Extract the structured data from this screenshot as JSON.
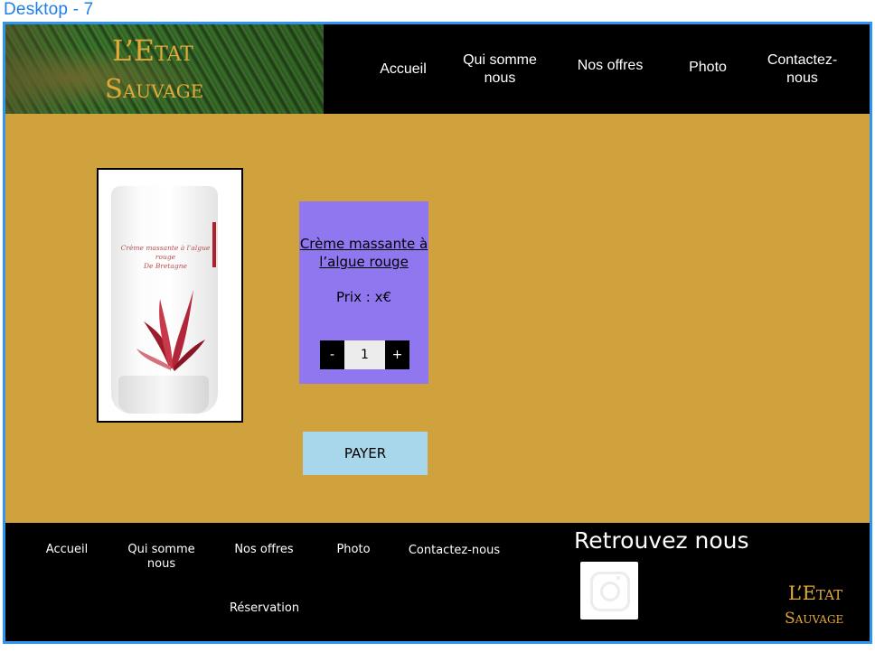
{
  "frame_label": "Desktop - 7",
  "brand": {
    "line1": "L’Etat",
    "line2": "Sauvage"
  },
  "nav": [
    {
      "label": "Accueil"
    },
    {
      "label": "Qui somme nous"
    },
    {
      "label": "Nos offres"
    },
    {
      "label": "Photo"
    },
    {
      "label": "Contactez-nous"
    }
  ],
  "product": {
    "name": "Crème massante à l’algue rouge",
    "price": "Prix : x€",
    "quantity": "1",
    "minus_label": "-",
    "plus_label": "+",
    "image_text": [
      "Crème massante à l’algue",
      "rouge",
      "De Bretagne"
    ]
  },
  "pay_label": "PAYER",
  "footer": {
    "links": [
      "Accueil",
      "Qui somme nous",
      "Nos offres",
      "Photo",
      "Contactez-nous",
      "Réservation"
    ],
    "follow_title": "Retrouvez nous",
    "social": "instagram-icon",
    "brand": {
      "line1": "L’Etat",
      "line2": "Sauvage"
    }
  },
  "colors": {
    "header_bg": "#000000",
    "main_bg": "#cfa23e",
    "card_bg": "#9077ef",
    "pay_bg": "#a8d6ea",
    "brand_gold": "#e2a93a",
    "frame_blue": "#2f95f0"
  }
}
